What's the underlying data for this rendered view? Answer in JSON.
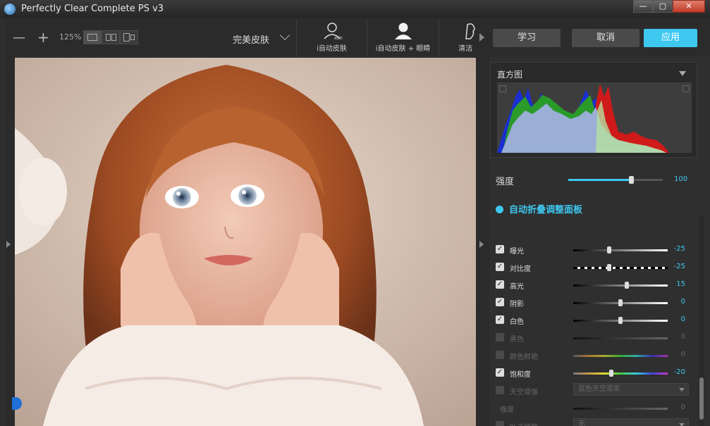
{
  "window": {
    "title": "Perfectly Clear Complete PS v3",
    "controls": [
      "—",
      "▢",
      "✕"
    ]
  },
  "toolbar": {
    "zoom_out": "—",
    "zoom_in": "+",
    "zoom_level": "125%",
    "preset_name": "完美皮肤",
    "presets": [
      {
        "label": "i自动皮肤",
        "icon": "person-auto-icon"
      },
      {
        "label": "i自动皮肤 + 眼睛",
        "icon": "person-icon"
      },
      {
        "label": "清洁",
        "icon": "profile-icon"
      }
    ]
  },
  "actions": {
    "learn": "学习",
    "cancel": "取消",
    "apply": "应用"
  },
  "panel": {
    "histogram_title": "直方图",
    "strength_label": "强度",
    "strength_value": 100,
    "strength_display": "100",
    "auto_fold_label": "自动折叠调整面板",
    "rows": [
      {
        "name": "曝光",
        "value": "-25",
        "checked": true,
        "enabled": true,
        "pos": 0.38,
        "track": "grad-bw"
      },
      {
        "name": "对比度",
        "value": "-25",
        "checked": true,
        "enabled": true,
        "pos": 0.38,
        "track": "grad-contrast"
      },
      {
        "name": "高光",
        "value": "15",
        "checked": true,
        "enabled": true,
        "pos": 0.57,
        "track": "grad-bw"
      },
      {
        "name": "阴影",
        "value": "0",
        "checked": true,
        "enabled": true,
        "pos": 0.5,
        "track": "grad-bw"
      },
      {
        "name": "白色",
        "value": "0",
        "checked": true,
        "enabled": true,
        "pos": 0.5,
        "track": "grad-bw"
      },
      {
        "name": "黑色",
        "value": "0",
        "checked": false,
        "enabled": false,
        "pos": 0.5,
        "track": "grad-bw-dim"
      },
      {
        "name": "颜色鲜艳",
        "value": "0",
        "checked": false,
        "enabled": false,
        "pos": 0.5,
        "track": "grad-rainbow-dim"
      },
      {
        "name": "饱和度",
        "value": "-20",
        "checked": true,
        "enabled": true,
        "pos": 0.4,
        "track": "grad-rainbow"
      },
      {
        "name": "天空增强",
        "value": "",
        "checked": false,
        "enabled": false,
        "dropdown": "蓝色天空是家"
      },
      {
        "name": "强度",
        "value": "0",
        "checked": null,
        "enabled": false,
        "pos": 0.0,
        "track": "grad-bw-dim"
      },
      {
        "name": "叶子增强",
        "value": "",
        "checked": false,
        "enabled": false,
        "dropdown": "无"
      }
    ]
  },
  "colors": {
    "accent": "#3ec8f0",
    "panel_bg": "#2f2f2f",
    "toolbar_bg": "#2b2b2b",
    "window_close": "#c0392b"
  }
}
